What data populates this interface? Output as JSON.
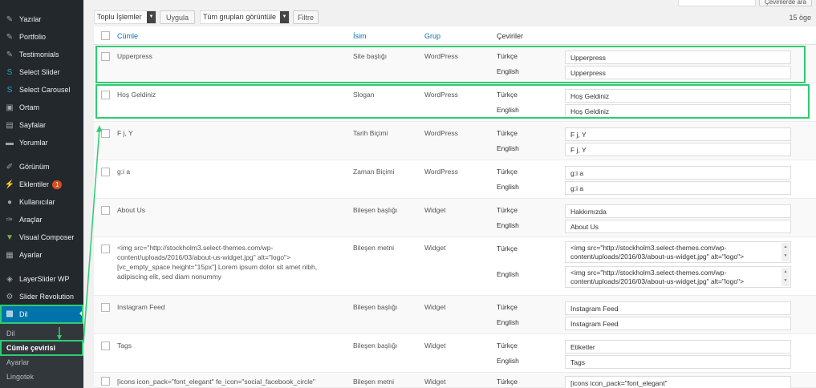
{
  "sidebar": {
    "items": [
      {
        "label": "Yazılar",
        "icon": "pin-icon",
        "glyph": "✎"
      },
      {
        "label": "Portfolio",
        "icon": "pin-icon",
        "glyph": "✎"
      },
      {
        "label": "Testimonials",
        "icon": "pin-icon",
        "glyph": "✎"
      },
      {
        "label": "Select Slider",
        "icon": "select-s-icon",
        "glyph": "S"
      },
      {
        "label": "Select Carousel",
        "icon": "select-s-icon",
        "glyph": "S"
      },
      {
        "label": "Ortam",
        "icon": "media-icon",
        "glyph": "▣"
      },
      {
        "label": "Sayfalar",
        "icon": "pages-icon",
        "glyph": "▤"
      },
      {
        "label": "Yorumlar",
        "icon": "comments-icon",
        "glyph": "▬"
      },
      {
        "label": "Görünüm",
        "icon": "appearance-icon",
        "glyph": "✐"
      },
      {
        "label": "Eklentiler",
        "icon": "plugins-icon",
        "glyph": "⚡",
        "badge": "1"
      },
      {
        "label": "Kullanıcılar",
        "icon": "users-icon",
        "glyph": "●"
      },
      {
        "label": "Araçlar",
        "icon": "tools-icon",
        "glyph": "✑"
      },
      {
        "label": "Visual Composer",
        "icon": "visual-composer-icon",
        "glyph": "▼"
      },
      {
        "label": "Ayarlar",
        "icon": "settings-icon",
        "glyph": "▦"
      },
      {
        "label": "LayerSlider WP",
        "icon": "layerslider-icon",
        "glyph": "◈"
      },
      {
        "label": "Slider Revolution",
        "icon": "revolution-icon",
        "glyph": "⚙"
      },
      {
        "label": "Dil",
        "icon": "language-icon",
        "glyph": "▩"
      }
    ],
    "submenu": [
      "Dil",
      "Cümle çevirisi",
      "Ayarlar",
      "Lingotek"
    ]
  },
  "top": {
    "search_button": "Çevirilerde ara"
  },
  "toolbar": {
    "bulk_select": "Toplu İşlemler",
    "apply": "Uygula",
    "group_select": "Tüm grupları görüntüle",
    "filter": "Filtre",
    "count": "15 öge"
  },
  "columns": {
    "string": "Cümle",
    "name": "İsim",
    "group": "Grup",
    "translations": "Çeviriler"
  },
  "languages": {
    "tr": "Türkçe",
    "en": "English"
  },
  "rows": [
    {
      "string": "Upperpress",
      "name": "Site başlığı",
      "group": "WordPress",
      "tr": "Upperpress",
      "en": "Upperpress"
    },
    {
      "string": "Hoş Geldiniz",
      "name": "Slogan",
      "group": "WordPress",
      "tr": "Hoş Geldiniz",
      "en": "Hoş Geldiniz"
    },
    {
      "string": "F j, Y",
      "name": "Tarih Biçimi",
      "group": "WordPress",
      "tr": "F j, Y",
      "en": "F j, Y"
    },
    {
      "string": "g:i a",
      "name": "Zaman Biçimi",
      "group": "WordPress",
      "tr": "g:i a",
      "en": "g:i a"
    },
    {
      "string": "About Us",
      "name": "Bileşen başlığı",
      "group": "Widget",
      "tr": "Hakkımızda",
      "en": "About Us"
    },
    {
      "string": "<img src=\"http://stockholm3.select-themes.com/wp-content/uploads/2016/03/about-us-widget.jpg\" alt=\"logo\"> [vc_empty_space height=\"15px\"] Lorem ipsum dolor sit amet nibh, adipiscing elit, sed diam nonummy",
      "name": "Bileşen metni",
      "group": "Widget",
      "tr": "<img src=\"http://stockholm3.select-themes.com/wp-content/uploads/2016/03/about-us-widget.jpg\" alt=\"logo\">",
      "en": "<img src=\"http://stockholm3.select-themes.com/wp-content/uploads/2016/03/about-us-widget.jpg\" alt=\"logo\">"
    },
    {
      "string": "Instagram Feed",
      "name": "Bileşen başlığı",
      "group": "Widget",
      "tr": "Instagram Feed",
      "en": "Instagram Feed"
    },
    {
      "string": "Tags",
      "name": "Bileşen başlığı",
      "group": "Widget",
      "tr": "Etiketler",
      "en": "Tags"
    },
    {
      "string": "[icons icon_pack=\"font_elegant\" fe_icon=\"social_facebook_circle\"",
      "name": "Bileşen metni",
      "group": "Widget",
      "tr": "[icons icon_pack=\"font_elegant\"",
      "en": ""
    }
  ],
  "colors": {
    "accent": "#0073aa",
    "highlight": "#2ecc71",
    "sidebar": "#23282d"
  }
}
